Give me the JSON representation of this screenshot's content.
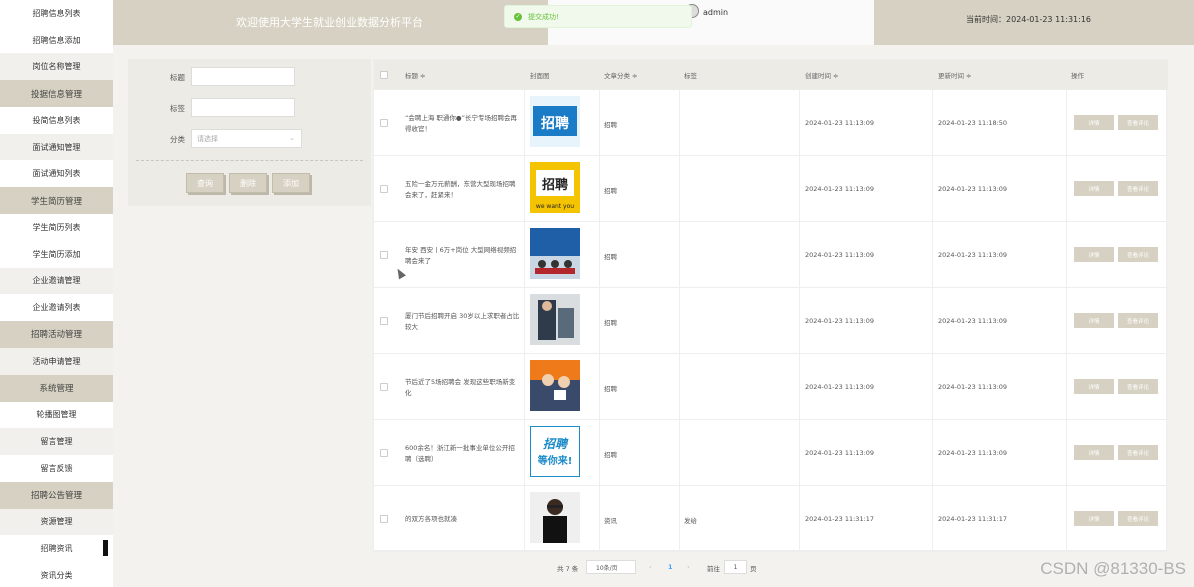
{
  "sidebar": {
    "items": [
      {
        "label": "招聘信息列表",
        "kind": "sub"
      },
      {
        "label": "招聘信息添加",
        "kind": "sub"
      },
      {
        "label": "岗位名称管理",
        "kind": "plain"
      },
      {
        "label": "投据信息管理",
        "kind": "group"
      },
      {
        "label": "投简信息列表",
        "kind": "sub"
      },
      {
        "label": "面试通知管理",
        "kind": "plain"
      },
      {
        "label": "面试通知列表",
        "kind": "sub"
      },
      {
        "label": "学生简历管理",
        "kind": "group"
      },
      {
        "label": "学生简历列表",
        "kind": "sub"
      },
      {
        "label": "学生简历添加",
        "kind": "sub"
      },
      {
        "label": "企业邀请管理",
        "kind": "plain"
      },
      {
        "label": "企业邀请列表",
        "kind": "sub"
      },
      {
        "label": "招聘活动管理",
        "kind": "group"
      },
      {
        "label": "活动申请管理",
        "kind": "plain"
      },
      {
        "label": "系统管理",
        "kind": "group"
      },
      {
        "label": "轮播图管理",
        "kind": "sub"
      },
      {
        "label": "留言管理",
        "kind": "plain"
      },
      {
        "label": "留言反馈",
        "kind": "sub"
      },
      {
        "label": "招聘公告管理",
        "kind": "group"
      },
      {
        "label": "资源管理",
        "kind": "plain"
      },
      {
        "label": "招聘资讯",
        "kind": "sub"
      },
      {
        "label": "资讯分类",
        "kind": "sub"
      }
    ]
  },
  "header": {
    "title": "欢迎使用大学生就业创业数据分析平台",
    "user": "admin",
    "time": "当前时间：2024-01-23 11:31:16"
  },
  "toast": {
    "message": "提交成功!"
  },
  "search": {
    "title_label": "标题",
    "tag_label": "标签",
    "category_label": "分类",
    "category_placeholder": "请选择",
    "query_button": "查询",
    "delete_button": "删除",
    "add_button": "添加"
  },
  "table": {
    "headers": {
      "title": "标题 ≑",
      "cover": "封面图",
      "category": "文章分类 ≑",
      "tag": "标签",
      "created": "创建时间 ≑",
      "updated": "更新时间 ≑",
      "actions": "操作"
    },
    "rows": [
      {
        "title": "“会聘上海 职通你●”长宁专场招聘会再得收官！",
        "category": "招聘",
        "tag": "",
        "created": "2024-01-23 11:13:09",
        "updated": "2024-01-23 11:18:50"
      },
      {
        "title": "五险一金万元薪酬，东营大型现场招聘会来了，赶紧来！",
        "category": "招聘",
        "tag": "",
        "created": "2024-01-23 11:13:09",
        "updated": "2024-01-23 11:13:09"
      },
      {
        "title": "年安 西安丨6万+岗位 大型网络视频招聘会来了",
        "category": "招聘",
        "tag": "",
        "created": "2024-01-23 11:13:09",
        "updated": "2024-01-23 11:13:09"
      },
      {
        "title": "厦门节后招聘开启 30岁以上求职者占比较大",
        "category": "招聘",
        "tag": "",
        "created": "2024-01-23 11:13:09",
        "updated": "2024-01-23 11:13:09"
      },
      {
        "title": "节后近了5场招聘会 发现这些职场新变化",
        "category": "招聘",
        "tag": "",
        "created": "2024-01-23 11:13:09",
        "updated": "2024-01-23 11:13:09"
      },
      {
        "title": "600余名！浙江新一批事业单位公开招聘（选聘）",
        "category": "招聘",
        "tag": "",
        "created": "2024-01-23 11:13:09",
        "updated": "2024-01-23 11:13:09"
      },
      {
        "title": "的双方各项也就凑",
        "category": "资讯",
        "tag": "发给",
        "created": "2024-01-23 11:31:17",
        "updated": "2024-01-23 11:31:17"
      }
    ],
    "detail_button": "详情",
    "comment_button": "查看评论"
  },
  "pager": {
    "total": "共 7 条",
    "page_size": "10条/页",
    "prev": "‹",
    "current": "1",
    "next": "›",
    "goto_label": "前往",
    "goto_value": "1",
    "goto_suffix": "页"
  },
  "watermark": "CSDN @81330-BS",
  "colors": {
    "accent": "#d6d1c2",
    "success": "#67c23a"
  }
}
